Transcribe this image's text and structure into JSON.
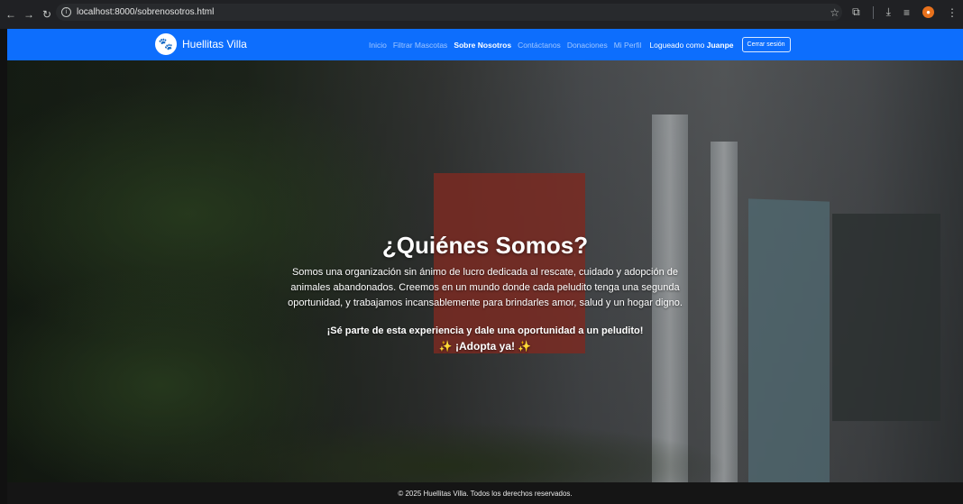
{
  "browser": {
    "url": "localhost:8000/sobrenosotros.html"
  },
  "navbar": {
    "brand": "Huellitas Villa",
    "links": [
      "Inicio",
      "Filtrar Mascotas",
      "Sobre Nosotros",
      "Contáctanos",
      "Donaciones",
      "Mi Perfil"
    ],
    "logged_prefix": "Logueado como",
    "username": "Juanpe",
    "logout_label": "Cerrar sesión",
    "color": "#0d6efd"
  },
  "hero": {
    "title": "¿Quiénes Somos?",
    "text": "Somos una organización sin ánimo de lucro dedicada al rescate, cuidado y adopción de animales abandonados. Creemos en un mundo donde cada peludito tenga una segunda oportunidad, y trabajamos incansablemente para brindarles amor, salud y un hogar digno.",
    "cta": "¡Sé parte de esta experiencia y dale una oportunidad a un peludito!",
    "adopt": "¡Adopta ya!",
    "sparkle": "✨"
  },
  "footer": {
    "text": "© 2025 Huellitas Villa. Todos los derechos reservados."
  }
}
